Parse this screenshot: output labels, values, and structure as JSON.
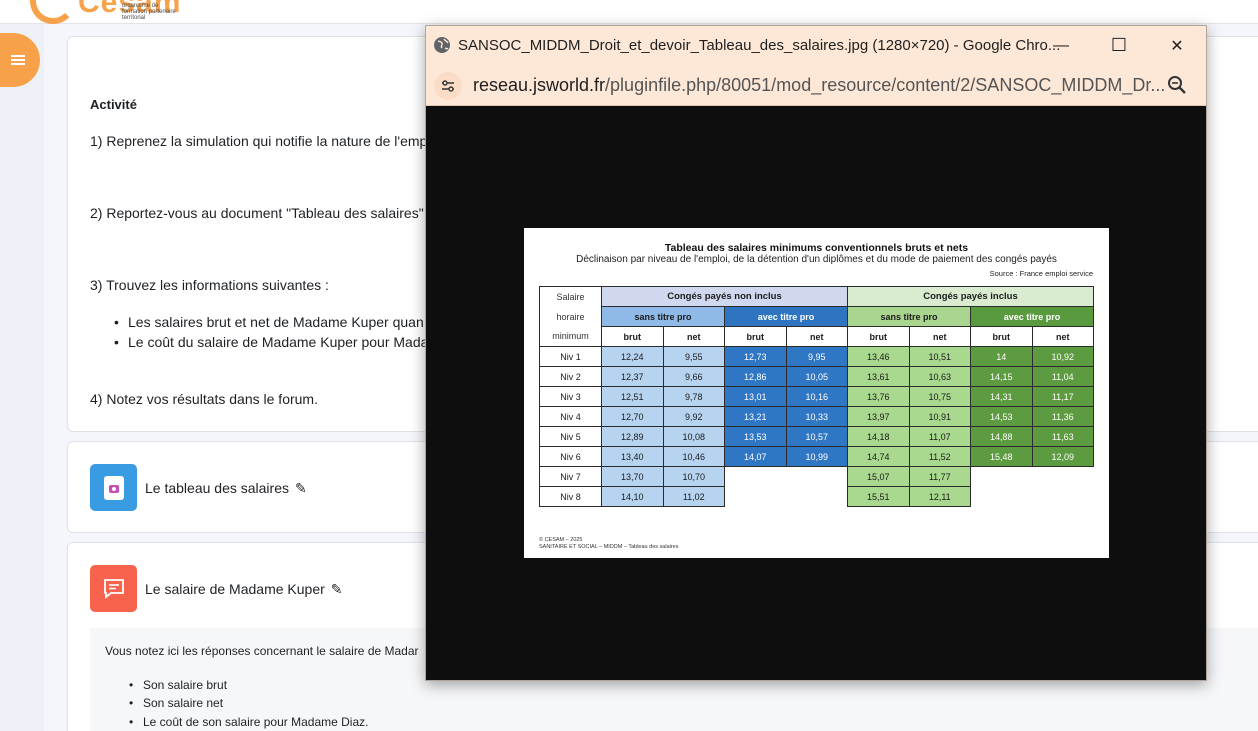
{
  "brand": {
    "name": "Cesam",
    "tagline": "organisme de formation partenaire territorial"
  },
  "activity": {
    "heading": "Activité",
    "step1": "1) Reprenez la simulation qui notifie la nature de l'emp",
    "step2": "2) Reportez-vous au document \"Tableau des salaires\"",
    "step3": "3) Trouvez les informations suivantes :",
    "bullet1": "Les salaires brut et net de Madame Kuper quan",
    "bullet2": "Le coût du salaire de Madame Kuper pour Mada",
    "step4": "4) Notez vos résultats dans le forum."
  },
  "resources": {
    "file_label": "Le tableau des salaires",
    "forum_label": "Le salaire de Madame Kuper",
    "forum_desc": "Vous notez ici les réponses concernant le salaire de Madar",
    "forum_items": [
      "Son salaire brut",
      "Son salaire net",
      "Le coût de son salaire pour Madame Diaz."
    ]
  },
  "popup": {
    "title": "SANSOC_MIDDM_Droit_et_devoir_Tableau_des_salaires.jpg (1280×720) - Google Chro...",
    "url_host": "reseau.jsworld.fr",
    "url_path": "/pluginfile.php/80051/mod_resource/content/2/SANSOC_MIDDM_Dr...",
    "minimize": "—",
    "maximize": "☐",
    "close": "✕"
  },
  "sheet": {
    "title": "Tableau des salaires minimums conventionnels bruts et nets",
    "subtitle": "Déclinaison par niveau de l'emploi, de la détention d'un diplômes et du mode de paiement des congés payés",
    "source": "Source : France emploi service",
    "footer_line1": "© CESAM – 2025",
    "footer_line2": "SANITAIRE ET SOCIAL – MIDDM – Tableau des salaires",
    "row_label_1": "Salaire",
    "row_label_2": "horaire",
    "row_label_3": "minimum",
    "group_left": "Congés payés non inclus",
    "group_right": "Congés payés inclus",
    "sub_no_title": "sans titre pro",
    "sub_with_title": "avec titre pro",
    "brut": "brut",
    "net": "net",
    "rows": [
      {
        "level": "Niv 1",
        "v": [
          "12,24",
          "9,55",
          "12,73",
          "9,95",
          "13,46",
          "10,51",
          "14",
          "10,92"
        ]
      },
      {
        "level": "Niv 2",
        "v": [
          "12,37",
          "9,66",
          "12,86",
          "10,05",
          "13,61",
          "10,63",
          "14,15",
          "11,04"
        ]
      },
      {
        "level": "Niv 3",
        "v": [
          "12,51",
          "9,78",
          "13,01",
          "10,16",
          "13,76",
          "10,75",
          "14,31",
          "11,17"
        ]
      },
      {
        "level": "Niv 4",
        "v": [
          "12,70",
          "9,92",
          "13,21",
          "10,33",
          "13,97",
          "10,91",
          "14,53",
          "11,36"
        ]
      },
      {
        "level": "Niv 5",
        "v": [
          "12,89",
          "10,08",
          "13,53",
          "10,57",
          "14,18",
          "11,07",
          "14,88",
          "11,63"
        ]
      },
      {
        "level": "Niv 6",
        "v": [
          "13,40",
          "10,46",
          "14,07",
          "10,99",
          "14,74",
          "11,52",
          "15,48",
          "12,09"
        ]
      },
      {
        "level": "Niv 7",
        "v": [
          "13,70",
          "10,70",
          "",
          "",
          "15,07",
          "11,77",
          "",
          ""
        ]
      },
      {
        "level": "Niv 8",
        "v": [
          "14,10",
          "11,02",
          "",
          "",
          "15,51",
          "12,11",
          "",
          ""
        ]
      }
    ]
  },
  "colors": {
    "accent_orange": "#f7a24a",
    "file_icon_blue": "#399be2",
    "forum_icon_red": "#f7634d",
    "chrome_bar": "#fde8d7"
  }
}
